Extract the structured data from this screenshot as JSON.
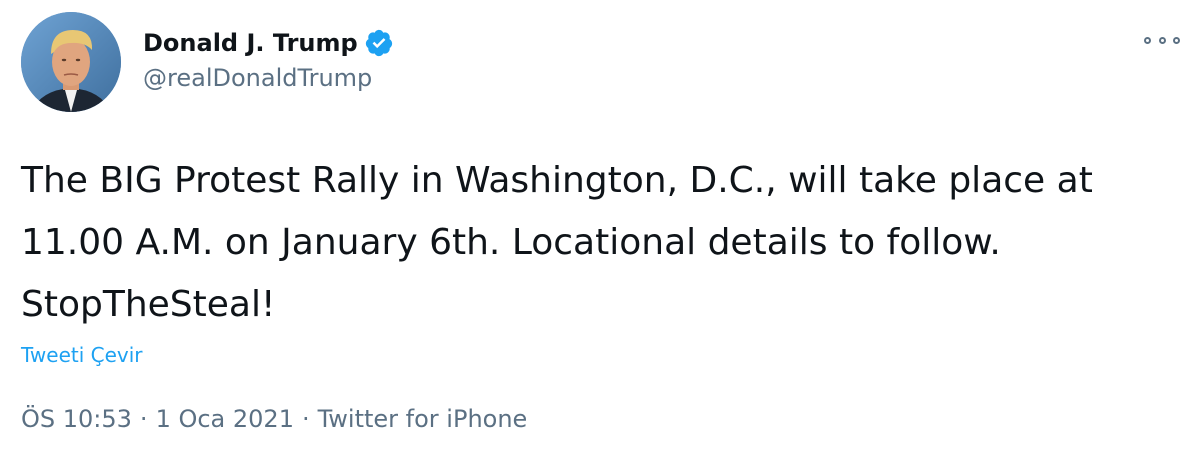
{
  "author": {
    "display_name": "Donald J. Trump",
    "handle": "@realDonaldTrump",
    "verified": true,
    "verified_icon": "verified-badge-icon",
    "avatar_icon": "avatar-portrait"
  },
  "tweet": {
    "text": "The BIG Protest Rally in Washington, D.C., will take place at 11.00 A.M. on January 6th. Locational details to follow. StopTheSteal!",
    "translate_label": "Tweeti Çevir"
  },
  "meta": {
    "time": "ÖS 10:53",
    "date": "1 Oca 2021",
    "source": "Twitter for iPhone",
    "separator": "·"
  },
  "more_menu_icon": "more-options-icon",
  "colors": {
    "accent": "#1da1f2",
    "text": "#0f1419",
    "secondary": "#5b7083",
    "background": "#ffffff"
  }
}
